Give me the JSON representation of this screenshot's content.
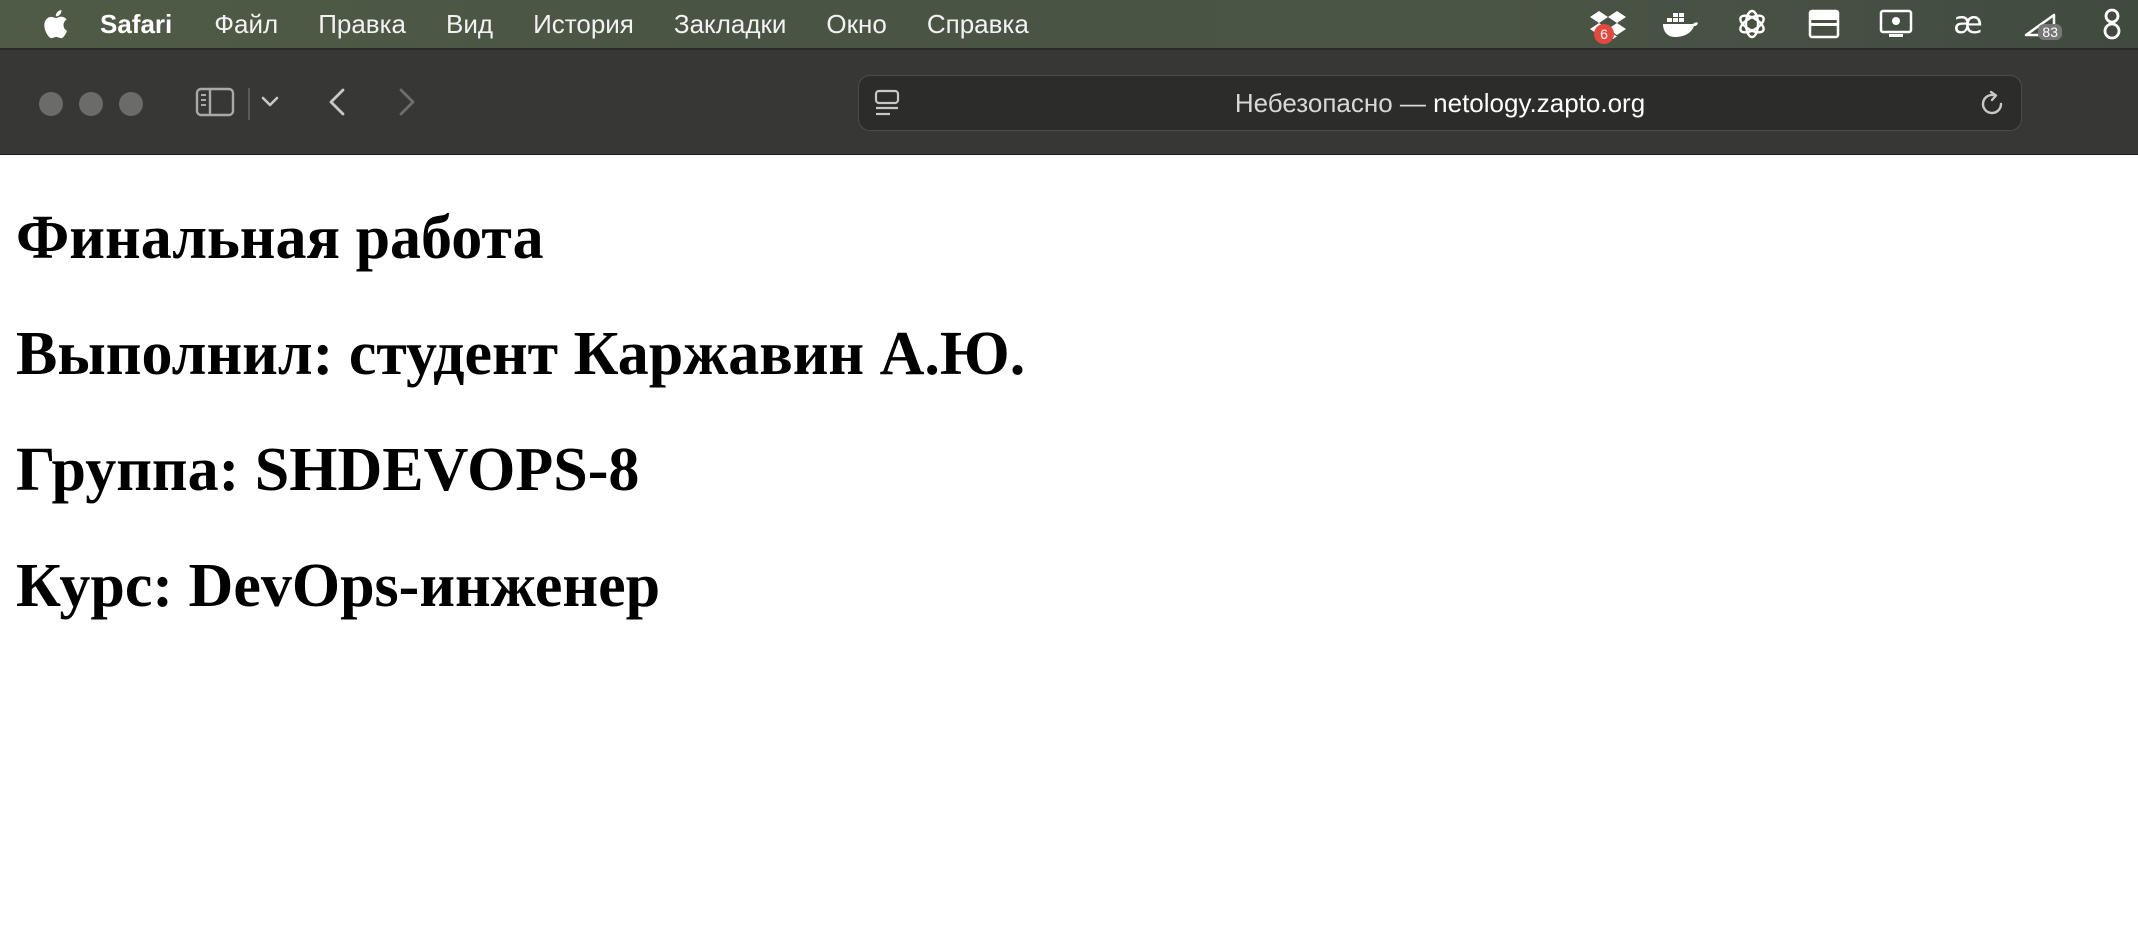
{
  "menubar": {
    "app_name": "Safari",
    "items": [
      "Файл",
      "Правка",
      "Вид",
      "История",
      "Закладки",
      "Окно",
      "Справка"
    ],
    "status_icons": [
      {
        "name": "dropbox-icon",
        "badge": "6"
      },
      {
        "name": "docker-icon"
      },
      {
        "name": "chatgpt-icon"
      },
      {
        "name": "window-manager-icon"
      },
      {
        "name": "screen-share-icon"
      },
      {
        "name": "ae-ligature-icon",
        "text": "æ"
      },
      {
        "name": "meter-icon",
        "value": "83"
      },
      {
        "name": "infinity-icon"
      }
    ]
  },
  "toolbar": {
    "address": {
      "security_label": "Небезопасно — ",
      "host": "netology.zapto.org"
    }
  },
  "page": {
    "heading1": "Финальная работа",
    "heading2": "Выполнил: студент Каржавин А.Ю.",
    "heading3": "Группа: SHDEVOPS-8",
    "heading4": "Курс: DevOps-инженер"
  },
  "colors": {
    "menubar_bg": "#4b5546",
    "toolbar_bg": "#373735",
    "addressbar_bg": "#2c2c2b",
    "badge_red": "#e5483f",
    "page_bg": "#ffffff"
  }
}
